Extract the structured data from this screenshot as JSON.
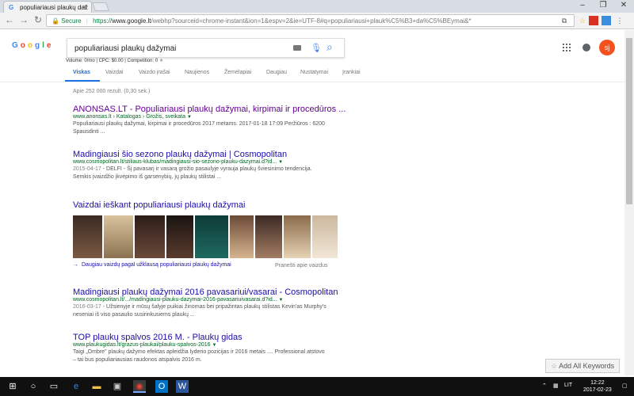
{
  "browser": {
    "tab_title": "populiariausi plaukų daž",
    "tab_favicon": "G",
    "close_tab": "×",
    "window_controls": [
      "–",
      "❐",
      "✕"
    ],
    "secure_label": "Secure",
    "url_scheme": "https://",
    "url_host": "www.google.lt",
    "url_path": "/webhp?sourceid=chrome-instant&ion=1&espv=2&ie=UTF-8#q=populiariausi+plauk%C5%B3+da%C5%BEymai&*"
  },
  "google": {
    "logo_text": "Google",
    "search_query": "populiariausi plaukų dažymai",
    "avatar_initials": "sj",
    "seo_bar": "Volume: 0/mo | CPC: $0.00 | Competition: 0",
    "tabs": [
      "Viskas",
      "Vaizdai",
      "Vaizdo įrašai",
      "Naujienos",
      "Žemėlapiai",
      "Daugiau",
      "Nustatymai",
      "Įrankiai"
    ],
    "stats": "Apie 252 000 rezult. (0,30 sek.)"
  },
  "results": [
    {
      "title": "ANONSAS.LT - Populiariausi plaukų dažymai, kirpimai ir procedūros ...",
      "url": "www.anonsas.lt › Katalogas › Grožis, sveikata",
      "snippet_date": "",
      "snippet": "Populiariausi plaukų dažymai, kirpimai ir procedūros 2017 metams. 2017-01-18 17:09 Peržiūros : 6200 Spausdinti ..."
    },
    {
      "title": "Madingiausi šio sezono plaukų dažymai | Cosmopolitan",
      "url": "www.cosmopolitan.lt/stiliaus-klubas/madingiausi-sio-sezono-plauku-dazymai.d?id...",
      "snippet_date": "2015-04-17",
      "snippet": " - DELFI - Šį pavasarį ir vasarą grožio pasaulyje vyrauja plaukų šviesinimo tendencija. Semkis įvaizdžio įkvėpimo iš garsenybių, jų plaukų stilistai ..."
    },
    {
      "title": "Madingiausi plaukų dažymai 2016 pavasariui/vasarai - Cosmopolitan",
      "url": "www.cosmopolitan.lt/.../madingiausi-plauku-dazymai-2016-pavasariuivasarai.d?id...",
      "snippet_date": "2016-03-17",
      "snippet": " - Užsienyje ir mūsų šalyje puikiai žinomas bei pripažintas plaukų stilistas Kevin'as Murphy's neseniai iš viso pasaulio susirinkusiems plaukų ..."
    },
    {
      "title": "TOP plaukų spalvos 2016 M. - Plaukų gidas",
      "url": "www.plaukugidas.lt/grazus-plaukai/plauku-spalvos-2016",
      "snippet_date": "",
      "snippet": "Taigi „Ombre\" plaukų dažymo efektas apleidžia lyderio pozicijas ir 2016 metais .... Professional atstovo – tai bus populiariausias raudonos atspalvis 2016 m."
    }
  ],
  "images": {
    "title": "Vaizdai ieškant populiariausi plaukų dažymai",
    "more_link": "Daugiau vaizdų pagal užklausą populiariausi plaukų dažymai",
    "report_link": "Pranešti apie vaizdus"
  },
  "extension": {
    "add_keywords": "Add All Keywords"
  },
  "taskbar": {
    "lang": "LIT",
    "time": "12:22",
    "date": "2017-02-23"
  }
}
